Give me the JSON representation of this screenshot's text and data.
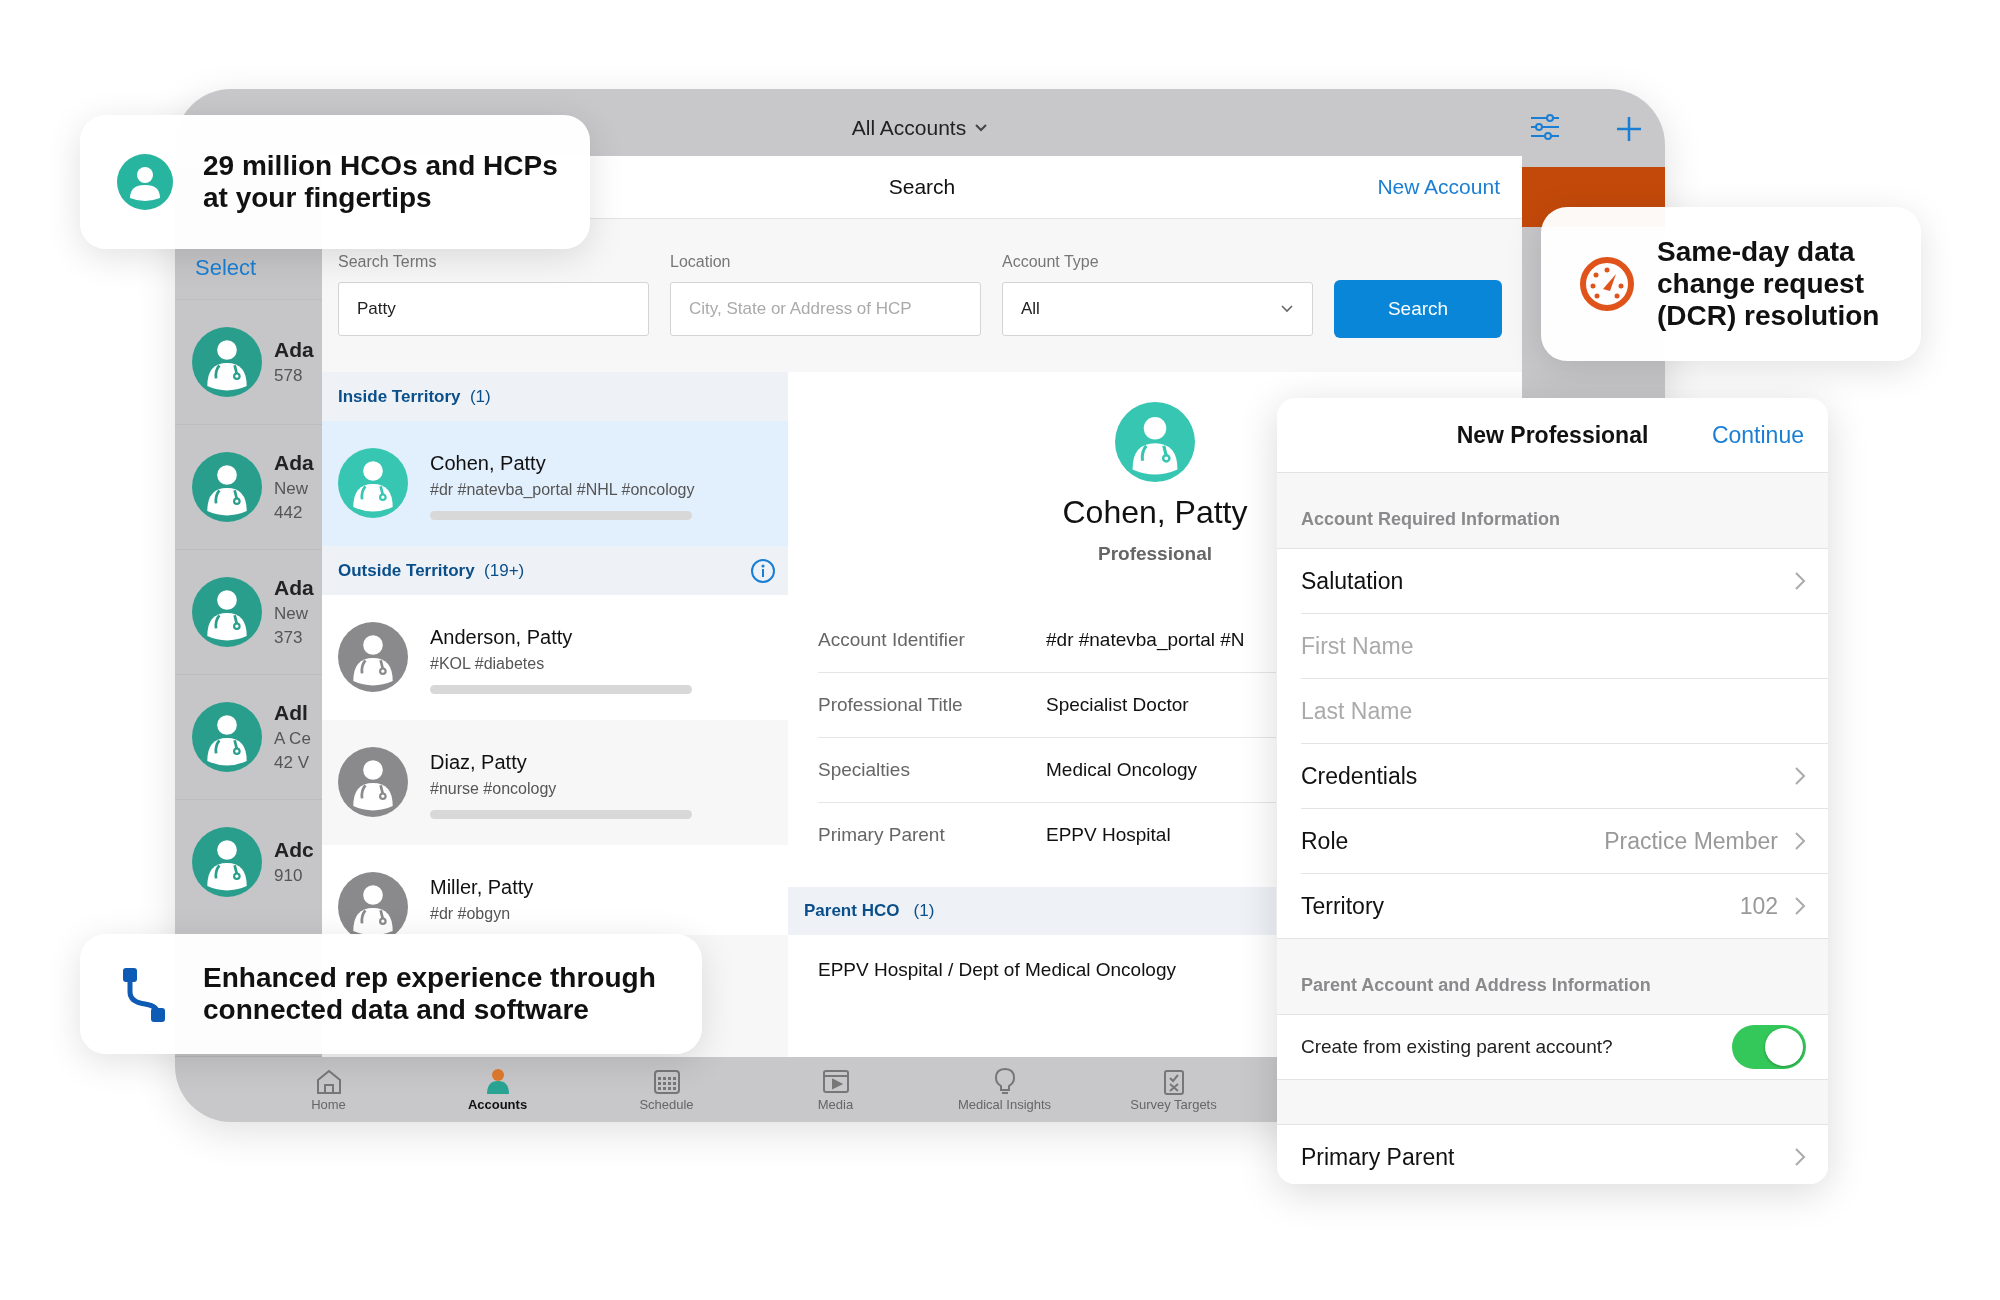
{
  "top_bar": {
    "title": "All Accounts"
  },
  "account_list": {
    "action": "Select",
    "rows": [
      {
        "name": "Ada",
        "lines": [
          "578"
        ]
      },
      {
        "name": "Ada",
        "lines": [
          "New",
          "442"
        ]
      },
      {
        "name": "Ada",
        "lines": [
          "New",
          "373"
        ]
      },
      {
        "name": "Adl",
        "lines": [
          "A Ce",
          "42 V"
        ]
      },
      {
        "name": "Adc",
        "lines": [
          "910"
        ]
      }
    ]
  },
  "search_panel": {
    "title": "Search",
    "action": "New Account",
    "fields": [
      {
        "kind": "text",
        "label": "Search Terms",
        "value": "Patty"
      },
      {
        "kind": "text",
        "label": "Location",
        "placeholder": "City, State or Address of HCP"
      },
      {
        "kind": "select",
        "label": "Account Type",
        "value": "All"
      }
    ],
    "button": "Search",
    "results": [
      {
        "title": "Inside Territory",
        "count": "(1)",
        "info": false,
        "items": [
          {
            "name": "Cohen, Patty",
            "tags": "#dr #natevba_portal #NHL #oncology",
            "in_territory": true,
            "selected": true
          }
        ]
      },
      {
        "title": "Outside Territory",
        "count": "(19+)",
        "info": true,
        "items": [
          {
            "name": "Anderson, Patty",
            "tags": "#KOL #diabetes",
            "in_territory": false,
            "selected": false
          },
          {
            "name": "Diaz, Patty",
            "tags": "#nurse #oncology",
            "in_territory": false,
            "selected": false
          },
          {
            "name": "Miller, Patty",
            "tags": "#dr #obgyn",
            "in_territory": false,
            "selected": false
          }
        ]
      }
    ]
  },
  "detail": {
    "name": "Cohen, Patty",
    "type": "Professional",
    "fields": [
      {
        "label": "Account Identifier",
        "value": "#dr #natevba_portal #N"
      },
      {
        "label": "Professional Title",
        "value": "Specialist Doctor"
      },
      {
        "label": "Specialties",
        "value": "Medical Oncology"
      },
      {
        "label": "Primary Parent",
        "value": "EPPV Hospital"
      }
    ],
    "parent_section": {
      "title": "Parent HCO",
      "count": "(1)",
      "items": [
        "EPPV Hospital / Dept of Medical Oncology"
      ]
    }
  },
  "new_professional": {
    "title": "New Professional",
    "action": "Continue",
    "sections": [
      {
        "title": "Account Required Information",
        "rows": [
          {
            "kind": "picker",
            "label": "Salutation"
          },
          {
            "kind": "input",
            "placeholder": "First Name"
          },
          {
            "kind": "input",
            "placeholder": "Last Name"
          },
          {
            "kind": "picker",
            "label": "Credentials"
          },
          {
            "kind": "picker",
            "label": "Role",
            "value": "Practice Member"
          },
          {
            "kind": "picker",
            "label": "Territory",
            "value": "102"
          }
        ]
      },
      {
        "title": "Parent Account and Address Information",
        "rows": [
          {
            "kind": "toggle",
            "label": "Create from existing parent account?",
            "on": true
          }
        ]
      },
      {
        "rows": [
          {
            "kind": "picker",
            "label": "Primary Parent"
          }
        ]
      }
    ]
  },
  "tab_bar": [
    {
      "label": "Home",
      "selected": false
    },
    {
      "label": "Accounts",
      "selected": true
    },
    {
      "label": "Schedule",
      "selected": false
    },
    {
      "label": "Media",
      "selected": false
    },
    {
      "label": "Medical Insights",
      "selected": false
    },
    {
      "label": "Survey Targets",
      "selected": false
    }
  ],
  "callouts": [
    {
      "kind": "person",
      "text": "29 million HCOs and HCPs at your fingertips"
    },
    {
      "kind": "gauge",
      "text": "Same-day data change request (DCR) resolution"
    },
    {
      "kind": "connection",
      "text": "Enhanced rep experience through connected data and software"
    }
  ]
}
